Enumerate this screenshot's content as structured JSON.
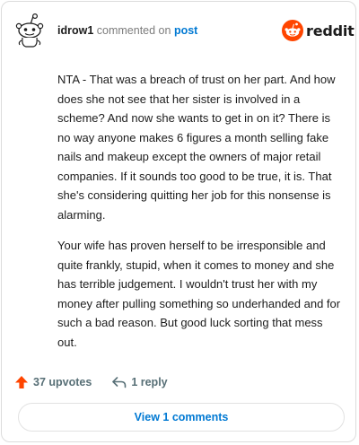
{
  "comment": {
    "username": "idrow1",
    "action_text": "commented on",
    "target_link": "post",
    "body": [
      "NTA - That was a breach of trust on her part. And how does she not see that her sister is involved in a scheme? And now she wants to get in on it? There is no way anyone makes 6 figures a month selling fake nails and makeup except the owners of major retail companies. If it sounds too good to be true, it is. That she's considering quitting her job for this nonsense is alarming.",
      "Your wife has proven herself to be irresponsible and quite frankly, stupid, when it comes to money and she has terrible judgement. I wouldn't trust her with my money after pulling something so underhanded and for such a bad reason. But good luck sorting that mess out."
    ]
  },
  "brand": {
    "name": "reddit",
    "color": "#ff4500"
  },
  "actions": {
    "upvotes_label": "37 upvotes",
    "replies_label": "1 reply"
  },
  "view_button": {
    "label": "View 1 comments"
  },
  "colors": {
    "upvote": "#ff4500",
    "link": "#0079d3",
    "meta": "#7c7c7c"
  }
}
